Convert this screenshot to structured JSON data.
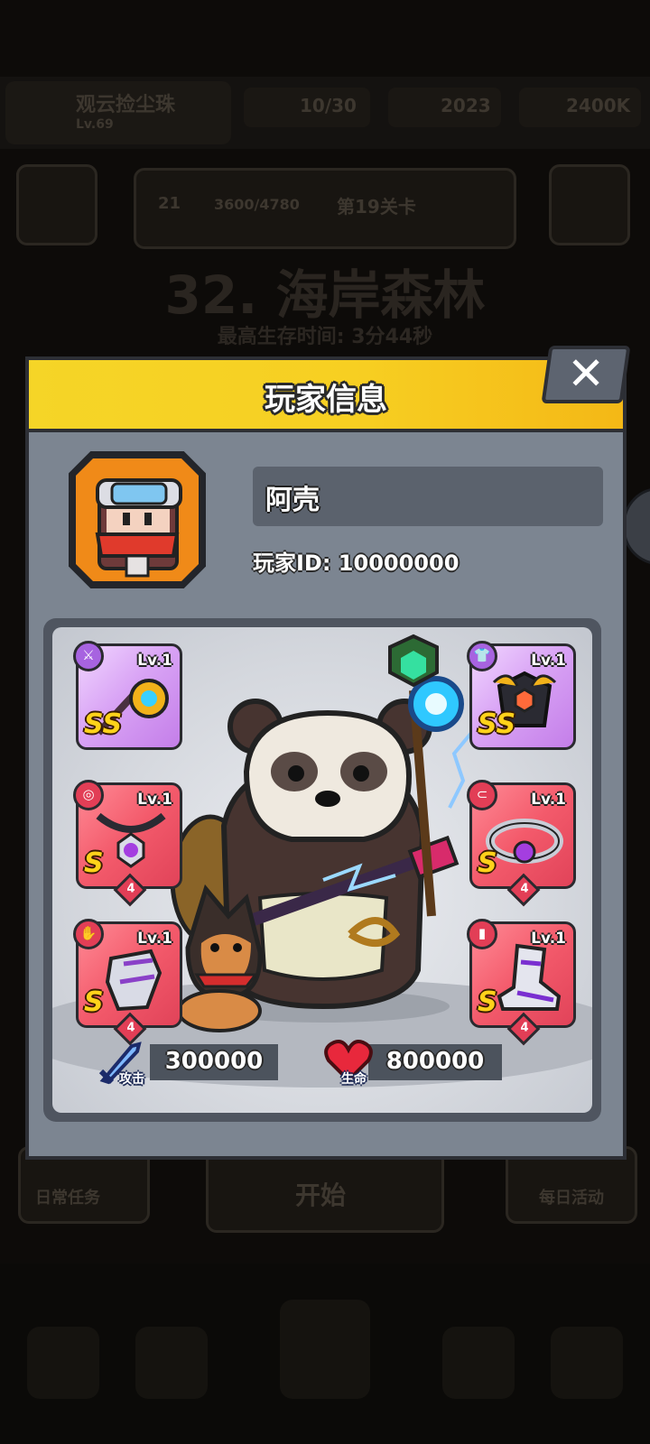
{
  "background": {
    "player_name": "观云捡尘珠",
    "level_text": "Lv.69",
    "resources": [
      "10/30",
      "2023",
      "2400K"
    ],
    "badge_level": "21",
    "progress_text": "3600/4780",
    "stage_info": "第19关卡",
    "stage_title": "32. 海岸森林",
    "stage_sub": "最高生存时间: 3分44秒",
    "bottom_left": "日常任务",
    "bottom_right": "每日活动",
    "center_action": "开始"
  },
  "modal": {
    "title": "玩家信息",
    "close_label": "✕",
    "player_name": "阿壳",
    "player_id": "玩家ID: 10000000"
  },
  "equipment": [
    {
      "slot": "weapon",
      "level": "Lv.1",
      "rank": "SS",
      "tier": "purple"
    },
    {
      "slot": "armor",
      "level": "Lv.1",
      "rank": "SS",
      "tier": "purple"
    },
    {
      "slot": "necklace",
      "level": "Lv.1",
      "rank": "S",
      "tier": "red",
      "stars": "4"
    },
    {
      "slot": "belt",
      "level": "Lv.1",
      "rank": "S",
      "tier": "red",
      "stars": "4"
    },
    {
      "slot": "gloves",
      "level": "Lv.1",
      "rank": "S",
      "tier": "red",
      "stars": "4"
    },
    {
      "slot": "boots",
      "level": "Lv.1",
      "rank": "S",
      "tier": "red",
      "stars": "4"
    }
  ],
  "stats": {
    "attack_label": "攻击",
    "attack_value": "300000",
    "hp_label": "生命",
    "hp_value": "800000"
  }
}
